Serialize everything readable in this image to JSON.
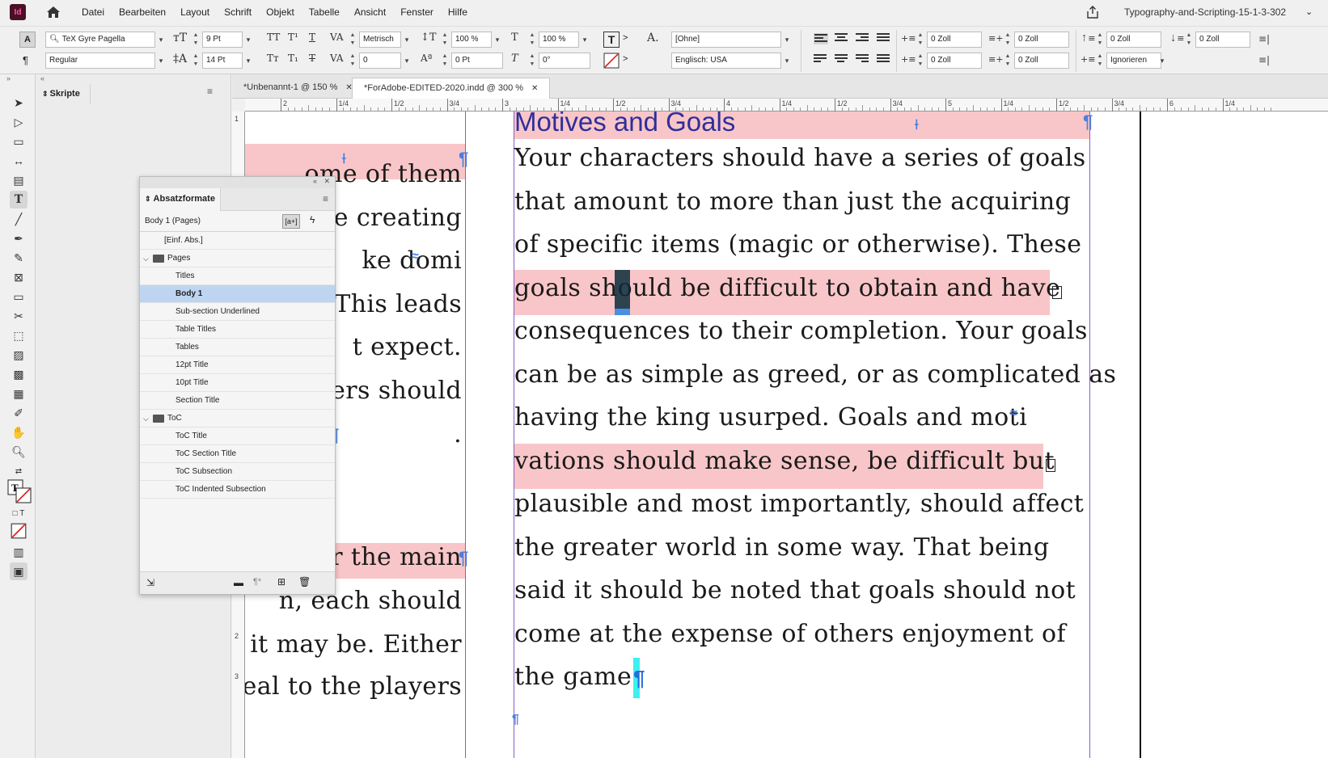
{
  "app": {
    "logo": "Id",
    "document_title": "Typography-and-Scripting-15-1-3-302"
  },
  "menu": [
    "Datei",
    "Bearbeiten",
    "Layout",
    "Schrift",
    "Objekt",
    "Tabelle",
    "Ansicht",
    "Fenster",
    "Hilfe"
  ],
  "control": {
    "font_family": "TeX Gyre Pagella",
    "font_style": "Regular",
    "font_size": "9 Pt",
    "leading": "14 Pt",
    "kerning": "Metrisch",
    "tracking": "0",
    "vscale": "100 %",
    "hscale": "100 %",
    "baseline_shift": "0 Pt",
    "skew": "0°",
    "char_style": "[Ohne]",
    "language": "Englisch: USA",
    "indent_left": "0 Zoll",
    "indent_right": "0 Zoll",
    "first_line": "0 Zoll",
    "last_line": "0 Zoll",
    "space_before": "0 Zoll",
    "space_after": "0 Zoll",
    "drop_cap_lines": "0 Zoll",
    "grid_align": "Ignorieren"
  },
  "panels": {
    "scripts_tab": "Skripte",
    "paragraph_styles": {
      "title": "Absatzformate",
      "current": "Body 1 (Pages)",
      "items": [
        {
          "label": "[Einf. Abs.]",
          "level": 1,
          "selected": false
        },
        {
          "label": "Pages",
          "level": 0,
          "group": true,
          "selected": false
        },
        {
          "label": "Titles",
          "level": 2,
          "selected": false
        },
        {
          "label": "Body 1",
          "level": 2,
          "selected": true
        },
        {
          "label": "Sub-section Underlined",
          "level": 2,
          "selected": false
        },
        {
          "label": "Table Titles",
          "level": 2,
          "selected": false
        },
        {
          "label": "Tables",
          "level": 2,
          "selected": false
        },
        {
          "label": "12pt Title",
          "level": 2,
          "selected": false
        },
        {
          "label": "10pt Title",
          "level": 2,
          "selected": false
        },
        {
          "label": "Section Title",
          "level": 2,
          "selected": false
        },
        {
          "label": "ToC",
          "level": 0,
          "group": true,
          "selected": false
        },
        {
          "label": "ToC Title",
          "level": 2,
          "selected": false
        },
        {
          "label": "ToC Section Title",
          "level": 2,
          "selected": false
        },
        {
          "label": "ToC Subsection",
          "level": 2,
          "selected": false
        },
        {
          "label": "ToC Indented Subsection",
          "level": 2,
          "selected": false
        }
      ]
    }
  },
  "doc_tabs": [
    {
      "label": "*Unbenannt-1 @ 150 %",
      "active": false
    },
    {
      "label": "*ForAdobe-EDITED-2020.indd @ 300 %",
      "active": true
    }
  ],
  "ruler_labels": [
    "2",
    "1/4",
    "1/2",
    "3/4",
    "3",
    "1/4",
    "1/2",
    "3/4",
    "4",
    "1/4",
    "1/2",
    "3/4",
    "5",
    "1/4",
    "1/2",
    "3/4",
    "6",
    "1/4"
  ],
  "ruler_v_labels": [
    "1",
    "1",
    "2",
    "3"
  ],
  "left_column": {
    "lines": [
      "ome of them",
      "e creating",
      "ke domi",
      "This leads",
      "t expect.",
      "yers should",
      ".",
      "ts or the main",
      "n, each should",
      "it may be. Either",
      "eal to the players"
    ]
  },
  "right_column": {
    "heading": "Motives and Goals",
    "lines": [
      "Your characters should have a series of goals",
      "that amount to more than just the acquiring",
      "of specific items (magic or otherwise). These",
      "goals should be difficult to obtain and have",
      "consequences to their completion. Your goals",
      "can be as simple as greed, or as complicated as",
      "having the king usurped. Goals and moti",
      "vations should make sense, be difficult but",
      "plausible and most importantly, should affect",
      "the greater world in some way. That being",
      "said it should be noted that goals should not",
      "come at the expense of others enjoyment of",
      "the game."
    ]
  },
  "colors": {
    "highlight": "#f8c6c8",
    "heading": "#2f2f9a",
    "frame": "#8a5cc7",
    "selection": "#bdd5f0"
  }
}
